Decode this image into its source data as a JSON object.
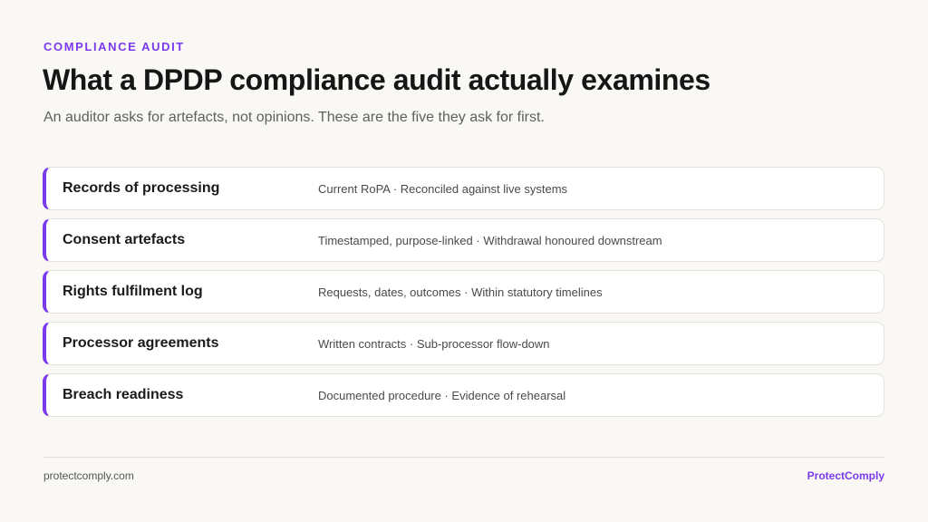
{
  "header": {
    "eyebrow": "COMPLIANCE AUDIT",
    "title": "What a DPDP compliance audit actually examines",
    "subtitle": "An auditor asks for artefacts, not opinions. These are the five they ask for first."
  },
  "items": [
    {
      "label": "Records of processing",
      "detail": "Current RoPA · Reconciled against live systems"
    },
    {
      "label": "Consent artefacts",
      "detail": "Timestamped, purpose-linked · Withdrawal honoured downstream"
    },
    {
      "label": "Rights fulfilment log",
      "detail": "Requests, dates, outcomes · Within statutory timelines"
    },
    {
      "label": "Processor agreements",
      "detail": "Written contracts · Sub-processor flow-down"
    },
    {
      "label": "Breach readiness",
      "detail": "Documented procedure · Evidence of rehearsal"
    }
  ],
  "footer": {
    "url": "protectcomply.com",
    "brand": "ProtectComply"
  },
  "colors": {
    "accent": "#7c3aed",
    "background": "#f9f8f5"
  }
}
